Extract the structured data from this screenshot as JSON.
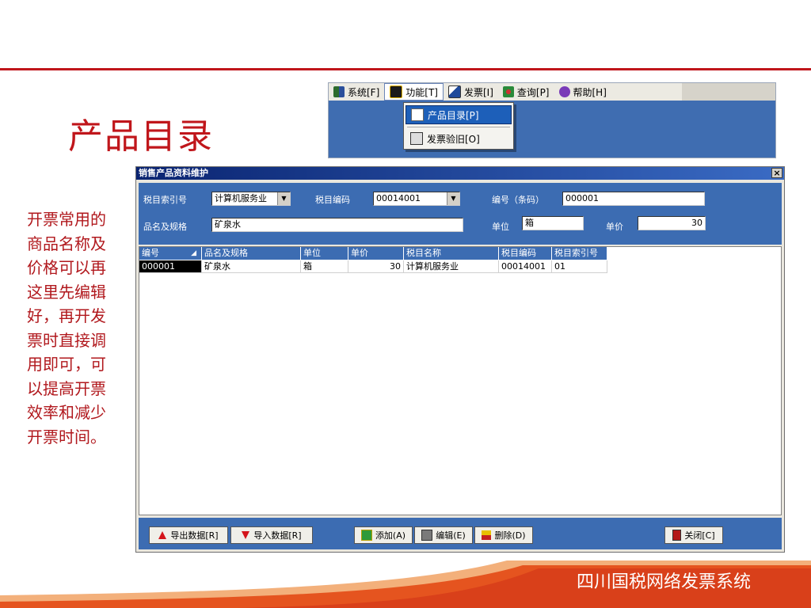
{
  "slide": {
    "title": "产品目录",
    "description": "开票常用的商品名称及价格可以再这里先编辑好，再开发票时直接调用即可，可以提高开票效率和减少开票时间。",
    "footer": "四川国税网络发票系统"
  },
  "colors": {
    "accent": "#c0161b",
    "panel": "#3c6cb2",
    "titlebar": "#0a2471"
  },
  "menubar": {
    "items": [
      {
        "label": "系统[F]",
        "icon": "system-icon"
      },
      {
        "label": "功能[T]",
        "icon": "function-icon"
      },
      {
        "label": "发票[I]",
        "icon": "invoice-icon"
      },
      {
        "label": "查询[P]",
        "icon": "query-icon"
      },
      {
        "label": "帮助[H]",
        "icon": "help-icon"
      }
    ],
    "dropdown": [
      {
        "label": "产品目录[P]",
        "icon": "catalog-icon"
      },
      {
        "label": "发票验旧[O]",
        "icon": "verify-icon"
      }
    ]
  },
  "window": {
    "title": "销售产品资料维护",
    "close": "×"
  },
  "form": {
    "tax_index_label": "税目索引号",
    "tax_index_value": "计算机服务业",
    "tax_code_label": "税目编码",
    "tax_code_value": "00014001",
    "code_label": "编号（条码）",
    "code_value": "000001",
    "name_label": "品名及规格",
    "name_value": "矿泉水",
    "unit_label": "单位",
    "unit_value": "箱",
    "price_label": "单价",
    "price_value": "30"
  },
  "grid": {
    "headers": [
      "编号",
      "品名及规格",
      "单位",
      "单价",
      "税目名称",
      "税目编码",
      "税目索引号"
    ],
    "rows": [
      [
        "000001",
        "矿泉水",
        "箱",
        "30",
        "计算机服务业",
        "00014001",
        "01"
      ]
    ]
  },
  "buttons": {
    "export": "导出数据[R]",
    "import": "导入数据[R]",
    "add": "添加(A)",
    "edit": "编辑(E)",
    "delete": "删除(D)",
    "close": "关闭[C]"
  }
}
